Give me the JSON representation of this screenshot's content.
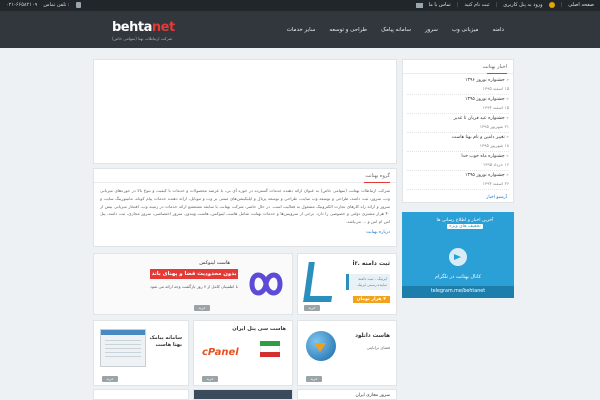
{
  "topbar": {
    "home": "صفحه اصلی",
    "login": "ورود به پنل کاربری",
    "register": "ثبت نام کنید",
    "contact": "تماس با ما",
    "phone_label": "تلفن تماس :",
    "phone": "۰۲۱-۶۶۵۸۲۱۰۹"
  },
  "header": {
    "brand_main": "behta",
    "brand_accent": "net",
    "tagline": "شرکت ارتباطات بهتا (سهامی خاص)"
  },
  "nav": [
    "دامنه",
    "میزبانی وب",
    "سرور",
    "سامانه پیامک",
    "طراحی و توسعه",
    "سایر خدمات"
  ],
  "about": {
    "heading": "گروه بهتانت",
    "body": "شرکت ارتباطات بهتانت (سهامی خاص) به عنوان ارائه دهنده خدمات گسترده در حوزه آی تی، با عرضه محصولات و خدمات با کیفیت و تنوع بالا در حوزه‌های میزبانی وب، سرور، ثبت دامنه، طراحی و توسعه وب سایت، طراحی و توسعه پرتال و اپلیکیشن‌های مبتنی بر وب و موبایل، ارائه دهنده خدمات پیام کوتاه، مانیتورینگ سایت و سرور و ارائه راه کارهای تجارت الکترونیک مشغول به فعالیت است. در حال حاضر، شرکت بهتانت با سابقه مشعشع ارائه خدمات در زمینه وب، افتخار میزبانی بیش از ۴۰ هزار مشتری دولتی و خصوصی را دارد. برخی از سرویس‌ها و خدمات بهتانت شامل هاست لینوکس، هاست ویندوز، سرور اختصاصی، سرور مجازی، ثبت دامنه، پنل اس ام اس و ... می‌باشد.",
    "more": "درباره بهتانت"
  },
  "news": {
    "heading": "اخبار بهتانت",
    "items": [
      {
        "title": "جشنواره نوروز ۱۳۹۶",
        "date": "۱۵ اسفند ۱۳۹۵"
      },
      {
        "title": "جشنواره نوروز ۱۳۹۵",
        "date": "۱۵ اسفند ۱۳۹۴"
      },
      {
        "title": "جشنواره عید قربان تا غدیر",
        "date": "۲۱ شهریور ۱۳۹۵"
      },
      {
        "title": "تغییر دامین و نام بهتا هاست",
        "date": "۱۸ شهریور ۱۳۹۵"
      },
      {
        "title": "جشنواره ماه خوب خدا",
        "date": "۱۶ خرداد ۱۳۹۵"
      },
      {
        "title": "جشنواره نوروز ۱۳۹۵",
        "date": "۲۶ اسفند ۱۳۹۴"
      }
    ],
    "archive": "آرشیو اخبار"
  },
  "telegram": {
    "line1": "آخرین اخبار و اطلاع رسانی ها",
    "line2": "تخفیف های ویژه",
    "channel": "کانال بهتانت در تلگرام",
    "url": "telegram.me/behtanet"
  },
  "cards": {
    "linux": {
      "title": "هاست لینوکس",
      "banner": "بدون محدودیت فضا و پهنای باند",
      "note": "با اطمینان کامل از ۷ روز بازگشت وجه ارائه می شود",
      "buy": "خرید"
    },
    "domain": {
      "title": "ثبت دامنه .ir",
      "box1": "ایرنیک - ثبت دامنه",
      "box2": "نماینده رسمی ایرنیک",
      "price": "۴ هزار تومان",
      "buy": "خرید"
    },
    "sms": {
      "title": "سامانه پیامک بهتا هاست",
      "buy": "خرید"
    },
    "cpanel": {
      "title": "هاست سی پنل ایران",
      "logo": "cPanel",
      "buy": "خرید"
    },
    "download": {
      "title": "هاست دانلود",
      "sub": "فضای ترابایتی",
      "buy": "خرید"
    },
    "strip_text": "سرور مجازی ایران"
  },
  "colors": {
    "accent": "#e53935",
    "topbar": "#20262a",
    "header": "#31373c",
    "telegram": "#2aa0d6",
    "link": "#1a73c8"
  }
}
